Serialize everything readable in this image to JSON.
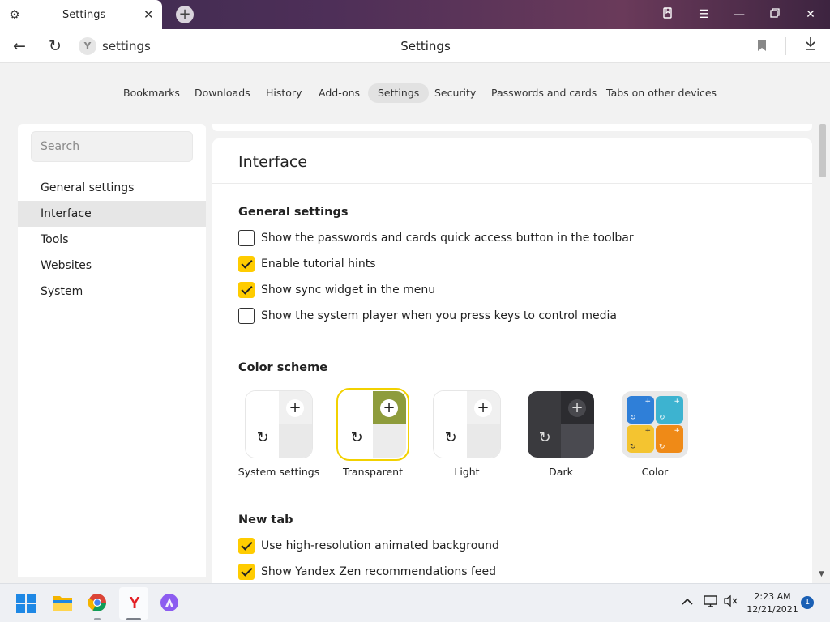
{
  "tab": {
    "title": "Settings",
    "icon": "gear-icon"
  },
  "address": {
    "text": "settings",
    "site_badge": "Y"
  },
  "page_title": "Settings",
  "section_nav": [
    {
      "label": "Bookmarks",
      "active": false
    },
    {
      "label": "Downloads",
      "active": false
    },
    {
      "label": "History",
      "active": false
    },
    {
      "label": "Add-ons",
      "active": false
    },
    {
      "label": "Settings",
      "active": true
    },
    {
      "label": "Security",
      "active": false
    },
    {
      "label": "Passwords and cards",
      "active": false
    },
    {
      "label": "Tabs on other devices",
      "active": false
    }
  ],
  "sidebar": {
    "search_placeholder": "Search",
    "items": [
      {
        "label": "General settings",
        "active": false
      },
      {
        "label": "Interface",
        "active": true
      },
      {
        "label": "Tools",
        "active": false
      },
      {
        "label": "Websites",
        "active": false
      },
      {
        "label": "System",
        "active": false
      }
    ]
  },
  "content": {
    "title": "Interface",
    "general": {
      "heading": "General settings",
      "options": [
        {
          "label": "Show the passwords and cards quick access button in the toolbar",
          "checked": false
        },
        {
          "label": "Enable tutorial hints",
          "checked": true
        },
        {
          "label": "Show sync widget in the menu",
          "checked": true
        },
        {
          "label": "Show the system player when you press keys to control media",
          "checked": false
        }
      ]
    },
    "color_scheme": {
      "heading": "Color scheme",
      "options": [
        {
          "label": "System settings",
          "selected": false
        },
        {
          "label": "Transparent",
          "selected": true
        },
        {
          "label": "Light",
          "selected": false
        },
        {
          "label": "Dark",
          "selected": false
        },
        {
          "label": "Color",
          "selected": false
        }
      ]
    },
    "new_tab": {
      "heading": "New tab",
      "options": [
        {
          "label": "Use high-resolution animated background",
          "checked": true
        },
        {
          "label": "Show Yandex Zen recommendations feed",
          "checked": true
        }
      ]
    }
  },
  "colors": {
    "accent": "#ffcc00",
    "selected_outline": "#f2d100",
    "titlebar": "#4e2f58"
  },
  "taskbar": {
    "time": "2:23 AM",
    "date": "12/21/2021",
    "notification_count": "1"
  }
}
